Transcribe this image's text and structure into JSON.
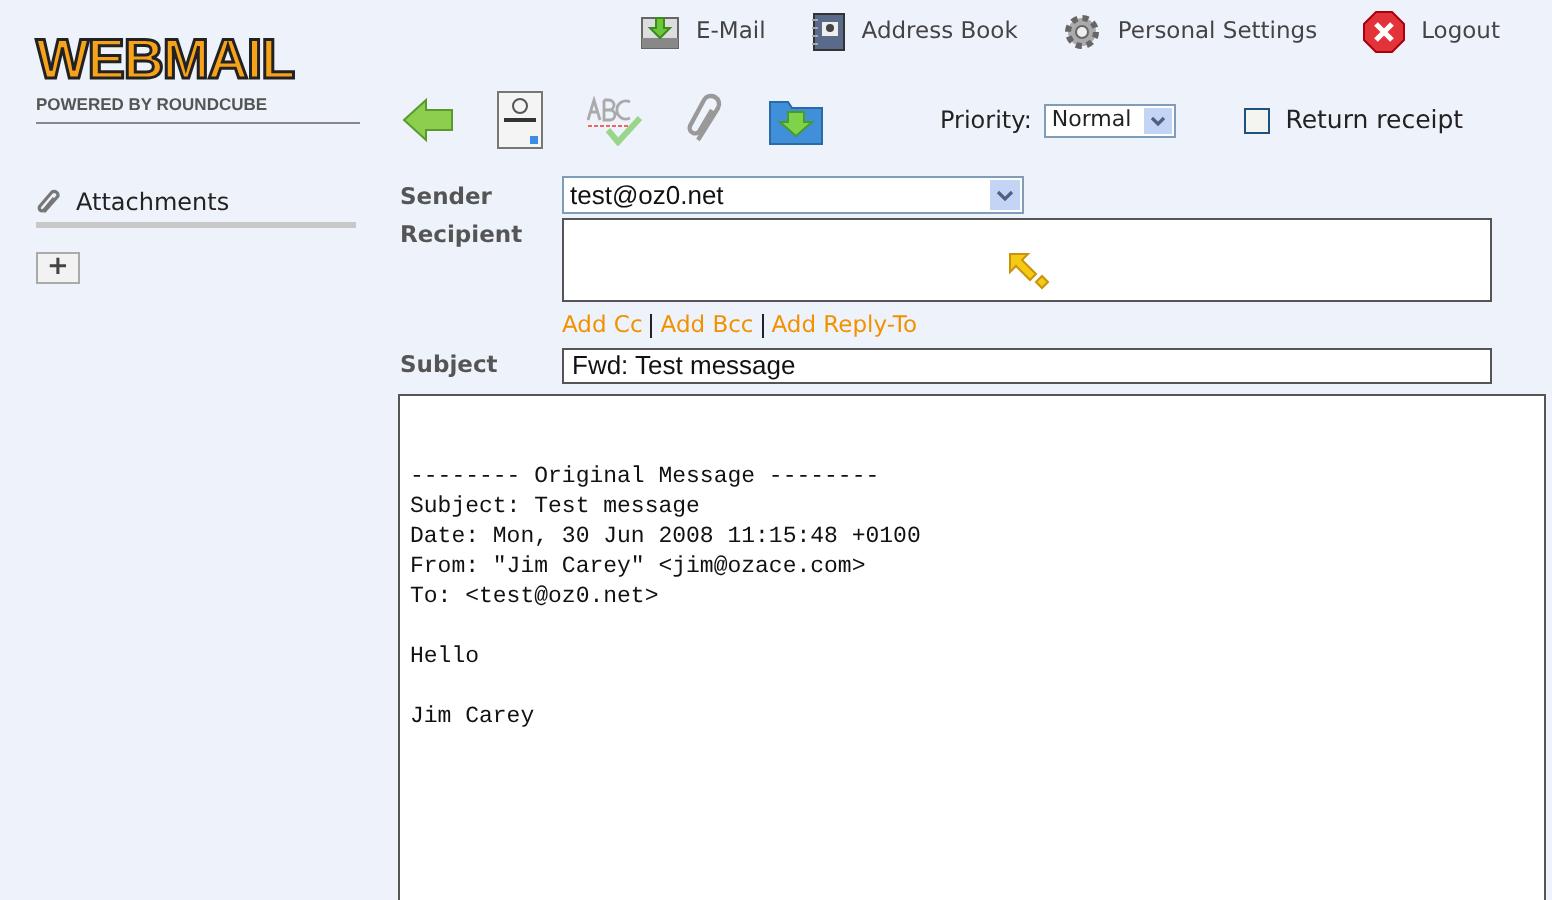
{
  "logo": {
    "title": "WEBMAIL",
    "subtitle": "POWERED BY ROUNDCUBE"
  },
  "nav": [
    {
      "kind": "mail",
      "label": "E-Mail"
    },
    {
      "kind": "addressbook",
      "label": "Address Book"
    },
    {
      "kind": "settings",
      "label": "Personal Settings"
    },
    {
      "kind": "logout",
      "label": "Logout"
    }
  ],
  "priority": {
    "label": "Priority:",
    "value": "Normal"
  },
  "return_receipt": {
    "label": "Return receipt",
    "checked": false
  },
  "sidebar": {
    "title": "Attachments",
    "add_button": "+"
  },
  "form": {
    "sender": {
      "label": "Sender",
      "value": "test@oz0.net"
    },
    "recipient": {
      "label": "Recipient"
    },
    "links": [
      "Add Cc",
      "Add Bcc",
      "Add Reply-To"
    ],
    "subject": {
      "label": "Subject",
      "value": "Fwd: Test message"
    }
  },
  "body": [
    [
      "-------- Original Message --------",
      "Subject: Test message",
      "Date: Mon, 30 Jun 2008 11:15:48 +0100",
      "From: \"Jim Carey\" <jim@ozace.com>",
      "To: <test@oz0.net>"
    ],
    [
      "Hello"
    ],
    [
      "Jim Carey"
    ]
  ]
}
